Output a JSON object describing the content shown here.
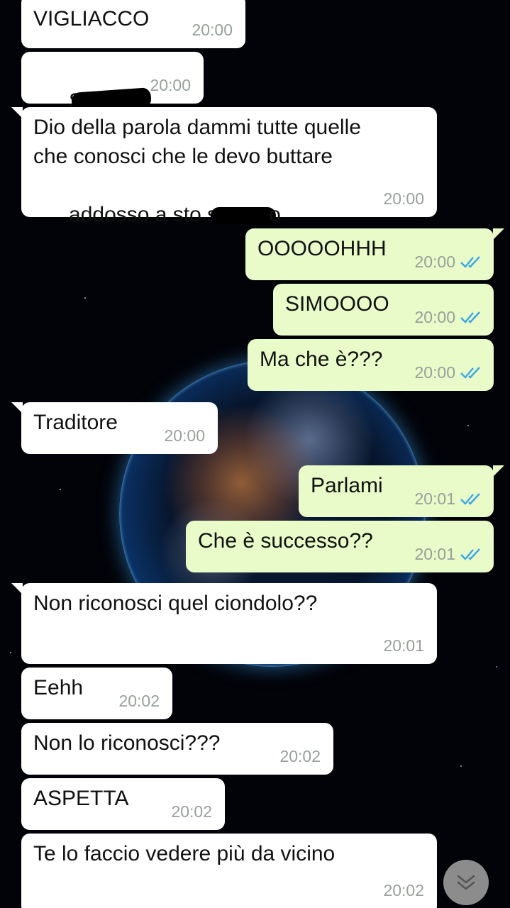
{
  "messages": [
    {
      "id": "m1",
      "direction": "in",
      "text": "VIGLIACCO",
      "time": "20:00"
    },
    {
      "id": "m2",
      "direction": "in",
      "text": "S",
      "text_after": "",
      "time": "20:00"
    },
    {
      "id": "m3",
      "direction": "in",
      "text_line1": "Dio della parola dammi tutte quelle",
      "text_line2": "che conosci che le devo buttare",
      "text_line3_prefix": "addosso a sto s",
      "text_line3_suffix": "o",
      "time": "20:00"
    },
    {
      "id": "m4",
      "direction": "out",
      "text": "OOOOOHHH",
      "time": "20:00",
      "status": "read"
    },
    {
      "id": "m5",
      "direction": "out",
      "text": "SIMOOOO",
      "time": "20:00",
      "status": "read"
    },
    {
      "id": "m6",
      "direction": "out",
      "text": "Ma che è???",
      "time": "20:00",
      "status": "read"
    },
    {
      "id": "m7",
      "direction": "in",
      "text": "Traditore",
      "time": "20:00"
    },
    {
      "id": "m8",
      "direction": "out",
      "text": "Parlami",
      "time": "20:01",
      "status": "read"
    },
    {
      "id": "m9",
      "direction": "out",
      "text": "Che è successo??",
      "time": "20:01",
      "status": "read"
    },
    {
      "id": "m10",
      "direction": "in",
      "text": "Non riconosci quel ciondolo??",
      "time": "20:01"
    },
    {
      "id": "m11",
      "direction": "in",
      "text": "Eehh",
      "time": "20:02"
    },
    {
      "id": "m12",
      "direction": "in",
      "text": "Non lo riconosci???",
      "time": "20:02"
    },
    {
      "id": "m13",
      "direction": "in",
      "text": "ASPETTA",
      "time": "20:02"
    },
    {
      "id": "m14",
      "direction": "in",
      "text": "Te lo faccio vedere più da vicino",
      "time": "20:02"
    }
  ],
  "icons": {
    "read_ticks": "double-check-icon",
    "scroll_down": "double-chevron-down-icon"
  },
  "colors": {
    "incoming_bubble": "#ffffff",
    "outgoing_bubble": "#e8fbc8",
    "read_ticks": "#3aa6e8",
    "timestamp": "#98a09a"
  }
}
